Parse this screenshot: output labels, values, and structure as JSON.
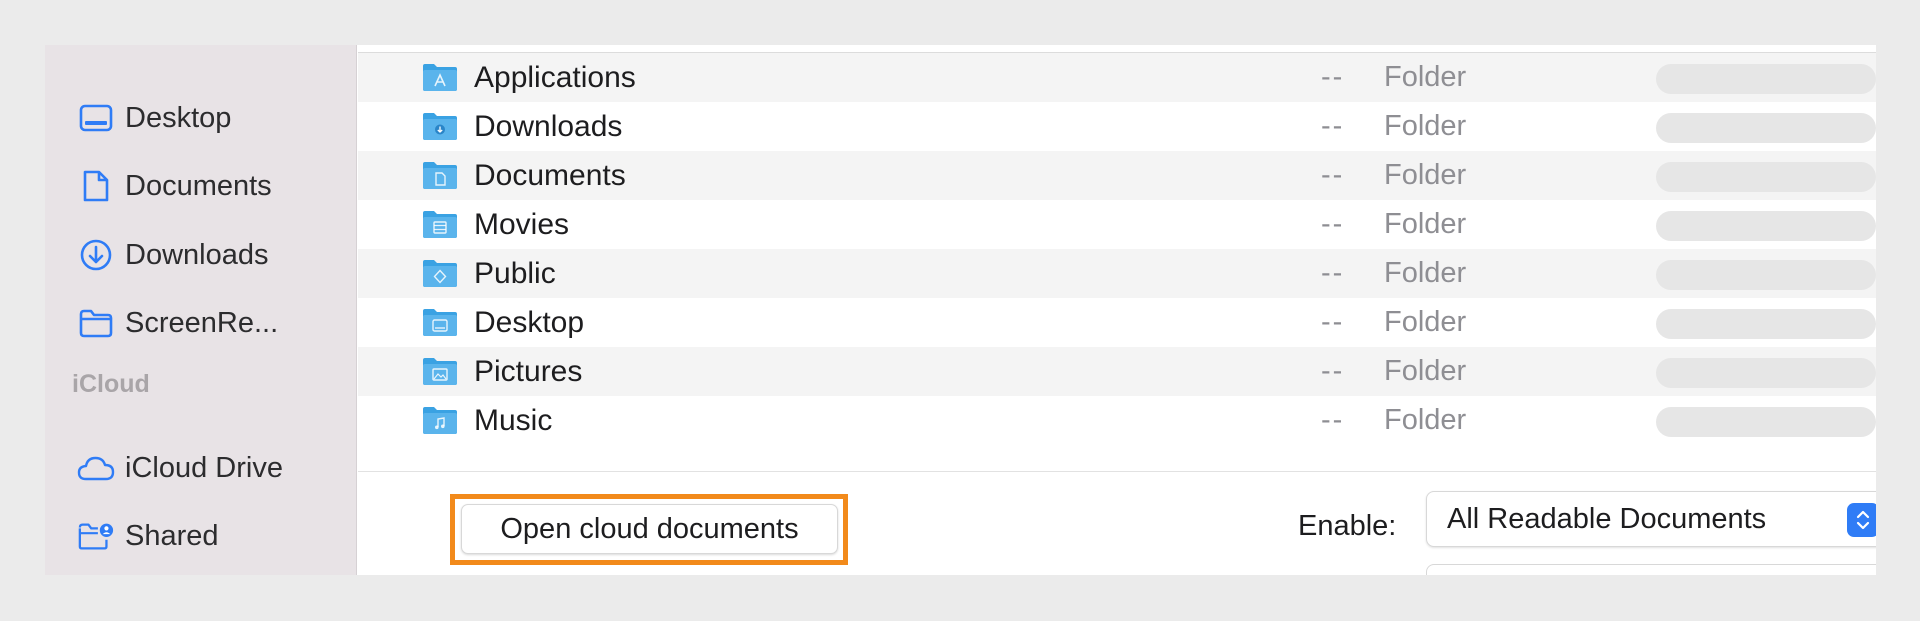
{
  "colors": {
    "accent": "#2f7cf6",
    "highlight_border": "#f28a1b",
    "folder_blue": "#5ab4ec",
    "sidebar_icon": "#2f7cf6"
  },
  "sidebar": {
    "items": [
      {
        "label": "Desktop",
        "icon": "desktop-icon"
      },
      {
        "label": "Documents",
        "icon": "document-icon"
      },
      {
        "label": "Downloads",
        "icon": "download-icon"
      },
      {
        "label": "ScreenRe...",
        "icon": "folder-icon"
      }
    ],
    "icloud_section": "iCloud",
    "icloud_items": [
      {
        "label": "iCloud Drive",
        "icon": "cloud-icon"
      },
      {
        "label": "Shared",
        "icon": "shared-folder-icon"
      }
    ]
  },
  "files": [
    {
      "name": "Applications",
      "size": "--",
      "kind": "Folder",
      "icon": "applications-folder-icon"
    },
    {
      "name": "Downloads",
      "size": "--",
      "kind": "Folder",
      "icon": "downloads-folder-icon"
    },
    {
      "name": "Documents",
      "size": "--",
      "kind": "Folder",
      "icon": "documents-folder-icon"
    },
    {
      "name": "Movies",
      "size": "--",
      "kind": "Folder",
      "icon": "movies-folder-icon"
    },
    {
      "name": "Public",
      "size": "--",
      "kind": "Folder",
      "icon": "public-folder-icon"
    },
    {
      "name": "Desktop",
      "size": "--",
      "kind": "Folder",
      "icon": "desktop-folder-icon"
    },
    {
      "name": "Pictures",
      "size": "--",
      "kind": "Folder",
      "icon": "pictures-folder-icon"
    },
    {
      "name": "Music",
      "size": "--",
      "kind": "Folder",
      "icon": "music-folder-icon"
    }
  ],
  "bottom": {
    "open_cloud_label": "Open cloud documents",
    "enable_label": "Enable:",
    "enable_value": "All Readable Documents"
  }
}
